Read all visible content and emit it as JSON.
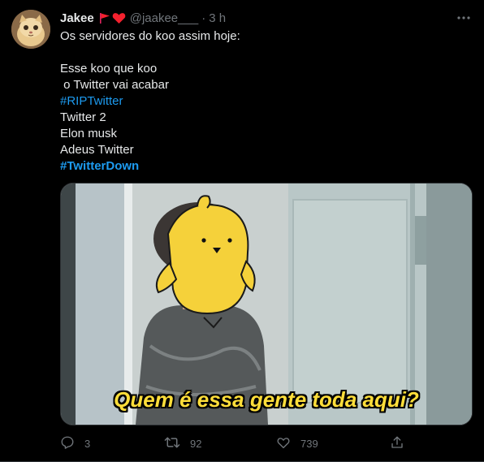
{
  "author": {
    "name": "Jakee",
    "handle": "@jaakee___",
    "separator": "·",
    "time": "3 h",
    "badges": [
      "flag-icon",
      "heart-icon"
    ]
  },
  "tweet": {
    "lines": [
      "Os servidores do koo assim hoje:",
      "",
      "Esse koo que koo",
      " o Twitter vai acabar",
      "#RIPTwitter",
      "Twitter 2",
      "Elon musk",
      "Adeus Twitter",
      "#TwitterDown"
    ],
    "media_caption": "Quem é essa gente toda aqui?"
  },
  "actions": {
    "replies": "3",
    "retweets": "92",
    "likes": "739"
  },
  "colors": {
    "background": "#000000",
    "text": "#e7e9ea",
    "muted": "#71767b",
    "link": "#1d9bf0",
    "caption": "#ffde3a"
  }
}
